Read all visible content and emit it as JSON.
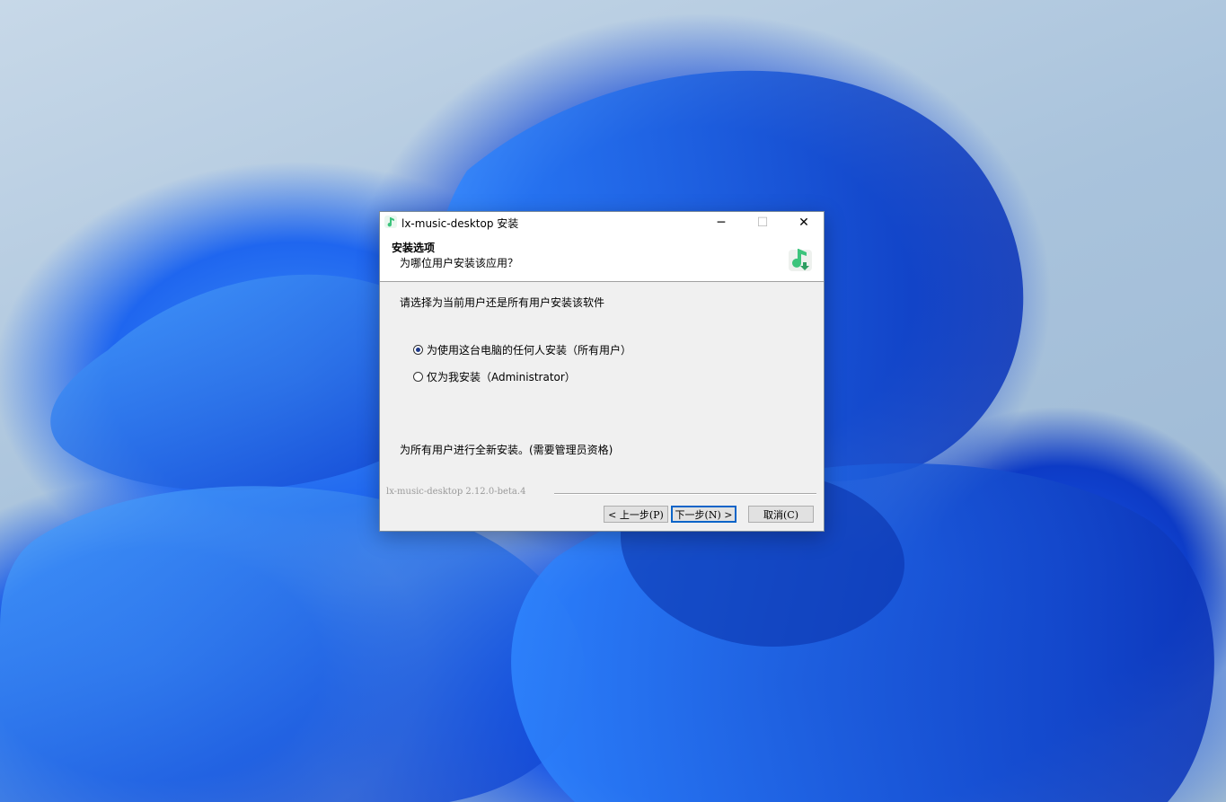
{
  "window": {
    "title": "lx-music-desktop 安装",
    "minimize_glyph": "─",
    "maximize_glyph": "☐",
    "close_glyph": "✕"
  },
  "header": {
    "title": "安装选项",
    "subtitle": "为哪位用户安装该应用？"
  },
  "body": {
    "prompt": "请选择为当前用户还是所有用户安装该软件",
    "options": [
      {
        "label": "为使用这台电脑的任何人安装（所有用户）",
        "selected": true
      },
      {
        "label": "仅为我安装（Administrator）",
        "selected": false
      }
    ],
    "info": "为所有用户进行全新安装。(需要管理员资格)"
  },
  "footer": {
    "version": "lx-music-desktop 2.12.0-beta.4",
    "back_label": "< 上一步(P)",
    "next_label": "下一步(N) >",
    "cancel_label": "取消(C)"
  },
  "colors": {
    "accent": "#0a64c8",
    "logo_green": "#3cc47c"
  },
  "icons": [
    "app-icon",
    "music-install-logo-icon"
  ]
}
